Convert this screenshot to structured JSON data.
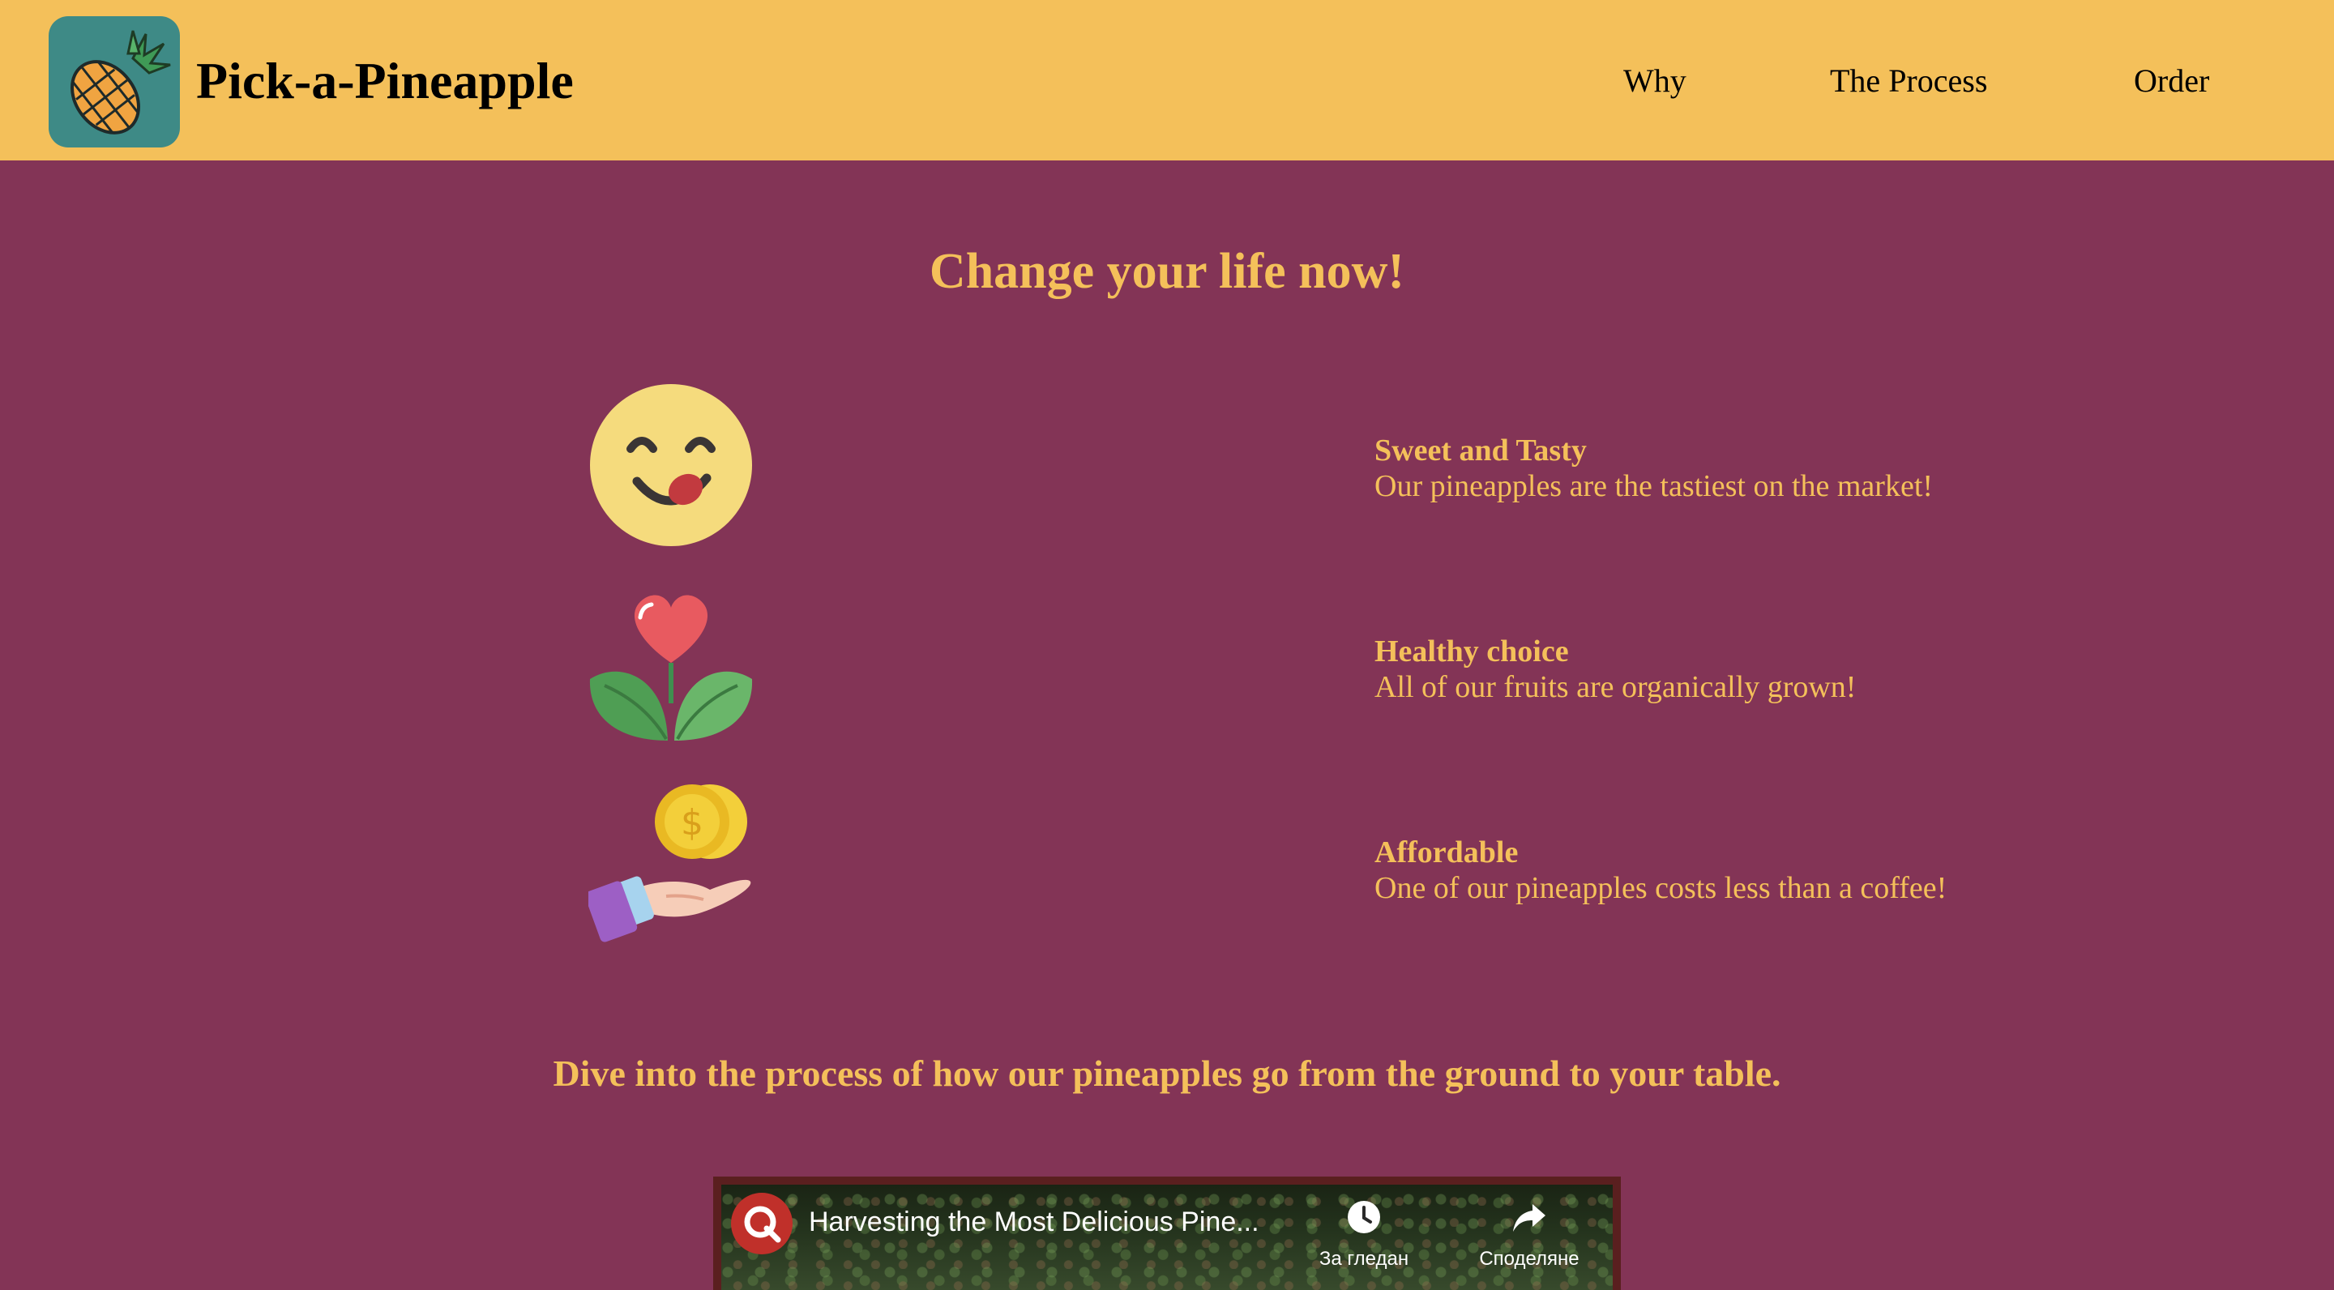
{
  "header": {
    "brand": "Pick-a-Pineapple",
    "logo_icon": "pineapple-icon",
    "background": "#f4c05a",
    "nav": [
      {
        "label": "Why"
      },
      {
        "label": "The Process"
      },
      {
        "label": "Order"
      }
    ]
  },
  "hero": {
    "title": "Change your life now!"
  },
  "features": [
    {
      "icon": "yummy-face-icon",
      "title": "Sweet and Tasty",
      "description": "Our pineapples are the tastiest on the market!"
    },
    {
      "icon": "heart-plant-icon",
      "title": "Healthy choice",
      "description": "All of our fruits are organically grown!"
    },
    {
      "icon": "coin-hand-icon",
      "title": "Affordable",
      "description": "One of our pineapples costs less than a coffee!"
    }
  ],
  "process": {
    "title": "Dive into the process of how our pineapples go from the ground to your table."
  },
  "video": {
    "title": "Harvesting the Most Delicious Pine...",
    "watch_later_label": "За гледан",
    "share_label": "Споделяне"
  },
  "colors": {
    "page_background": "#833456",
    "accent": "#f4c05a",
    "logo_background": "#3e8a86"
  }
}
